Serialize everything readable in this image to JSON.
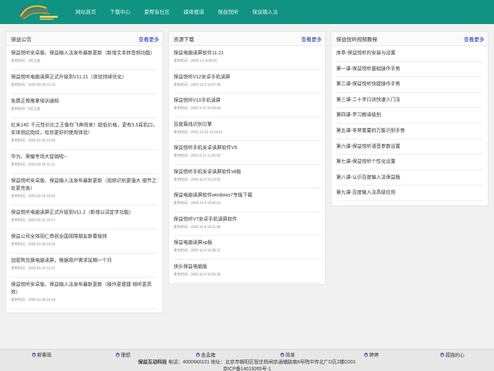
{
  "nav": {
    "items": [
      "网站首页",
      "下载中心",
      "爱帮盲社区",
      "媒体报道",
      "保益悦听",
      "保益输入法"
    ]
  },
  "columns": [
    {
      "title": "保益公告",
      "more": "查看更多",
      "items": [
        {
          "title": "保益悦听安卓版、保益输入法发布最新更新（新增文本转音频功能）",
          "time": "发布时间：3天之前"
        },
        {
          "title": "保益悦听电脑读屏正式升级到V11.21（体验持续优化）",
          "time": "发布时间：2025-02-24 10:13"
        },
        {
          "title": "免费正骨推拿培训通知",
          "time": "发布时间：6天之前"
        },
        {
          "title": "红米14C 千元性价比之王像你飞奔而来！超低价格，更有3.5耳机口，实体侧边指纹，给你更好的使用体验！",
          "time": "发布时间：2025-02-25 13:56"
        },
        {
          "title": "华为、荣耀专场大促销啦~",
          "time": "发布时间：2025-02-24 11:11"
        },
        {
          "title": "保益悦听安卓版、保益输入法发布最新更新（视频识别更强大 细节之处更完善）",
          "time": "发布时间：2025-02-19 16:02"
        },
        {
          "title": "保益悦听电脑读屏正式升级到V11.2（新增以词定字功能）",
          "time": "发布时间：2025-02-12 10:17"
        },
        {
          "title": "保益公司全体同仁恭祝全国视障朋友新春愉快",
          "time": "发布时间：2025-01-24 10:16"
        },
        {
          "title": "加密狗兑换电脑读屏，根据用户需求延期一个月",
          "time": "发布时间：2025-01-22 12:37"
        },
        {
          "title": "保益悦听安卓版、保益输入法发布最新更新（操作更便捷 倾听更高效）",
          "time": "发布时间：2025-01-20 10:14"
        }
      ]
    },
    {
      "title": "资源下载",
      "more": "查看更多",
      "items": [
        {
          "title": "保益电脑读屏软件11.21",
          "time": "发布时间：2025-1-2 9:08:26"
        },
        {
          "title": "保益悦听V12安卓手机读屏",
          "time": "发布时间：2023-12-2 10:37:36"
        },
        {
          "title": "保益悦听V10手机读屏",
          "time": "发布时间：2022-2-22 10:09:58"
        },
        {
          "title": "百度离线识别引擎",
          "time": "发布时间：2021-12-22 14:29:51"
        },
        {
          "title": "保益悦听手机安卓读屏软件V9",
          "time": "发布时间：2021-5-12 11:06:50"
        },
        {
          "title": "保益悦听手机安卓读屏软件v8版",
          "time": "发布时间：2020-11-4 16:23:02"
        },
        {
          "title": "保益电脑读屏软件windows7专版下载",
          "time": "发布时间：2024-12-4 14:40:01"
        },
        {
          "title": "保益悦听V7安卓手机读屏软件",
          "time": "发布时间：2020-11-4 16:31:09"
        },
        {
          "title": "保益电脑读屏xp版",
          "time": "发布时间：2020-11-4 16:28:11"
        },
        {
          "title": "快乐保益电脑版",
          "time": "发布时间：2020-11-4 16:20:16"
        }
      ]
    }
  ],
  "tutorials": {
    "title": "保益悦听视频教程",
    "more": "查看更多",
    "items": [
      "序章-保益悦听的安装与设置",
      "第一课-保益悦听基础操作手势",
      "第二课-保益悦听快捷操作手势",
      "第三课-二十字口诀快速入门法",
      "第四课-学习朗读级别",
      "第五课-非常重要的万能识别手势",
      "第六课-保益悦听语音参数设置",
      "第七课-保益悦听个性化设置",
      "第八课-认识百度输入法保益版",
      "第九课-百度输入法高级应用"
    ]
  },
  "footer": {
    "qq": [
      "斯雾雨",
      "理想",
      "金孟雍",
      "简单",
      "婷婷",
      "孤独的心"
    ],
    "brand": "保益互动科技",
    "contact": "电话：4000660101 地址：北京市朝阳区管庄杨闸京通辅路南8号院中传北广D区2楼D201",
    "icp": "京ICP备14019265号-1"
  },
  "colors": {
    "header_bg": "#0f9481",
    "more_link": "#1e2fa8",
    "qq_icon": "#2b5fb4"
  }
}
